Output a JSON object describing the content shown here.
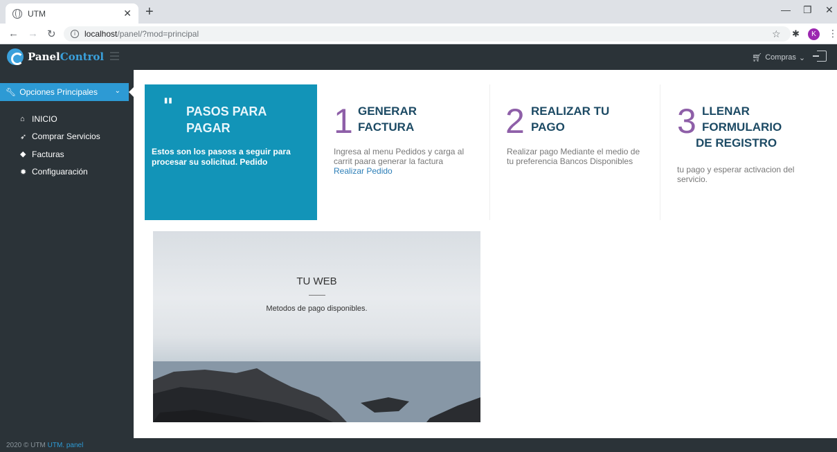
{
  "browser": {
    "tab_title": "UTM",
    "url_host": "localhost",
    "url_path": "/panel/?mod=principal",
    "profile_initial": "K"
  },
  "header": {
    "brand_part1": "Panel",
    "brand_part2": "Control",
    "compras_label": "Compras"
  },
  "sidebar": {
    "section_label": "Opciones Principales",
    "items": [
      {
        "label": "INICIO",
        "icon": "home-icon"
      },
      {
        "label": "Comprar Servicios",
        "icon": "send-icon"
      },
      {
        "label": "Facturas",
        "icon": "tag-icon"
      },
      {
        "label": "Configuaración",
        "icon": "gear-icon"
      }
    ]
  },
  "steps": {
    "hero": {
      "title": "PASOS PARA PAGAR",
      "text": "Estos son los pasoss a seguir para procesar su solicitud. Pedido"
    },
    "step1": {
      "number": "1",
      "title": "GENERAR FACTURA",
      "text": "Ingresa al menu Pedidos y carga al carrit paara generar la factura",
      "link": "Realizar Pedido"
    },
    "step2": {
      "number": "2",
      "title": "REALIZAR TU PAGO",
      "text": "Realizar pago Mediante el medio de tu preferencia Bancos Disponibles"
    },
    "step3": {
      "number": "3",
      "title_line1": "LLENAR",
      "title_line2": "FORMULARIO",
      "title_line3": "DE REGISTRO",
      "text": "tu pago y esperar activacion del servicio."
    }
  },
  "web_card": {
    "title": "TU WEB",
    "subtitle": "Metodos de pago disponibles."
  },
  "footer": {
    "text": "2020 © UTM",
    "link": "UTM. panel"
  }
}
